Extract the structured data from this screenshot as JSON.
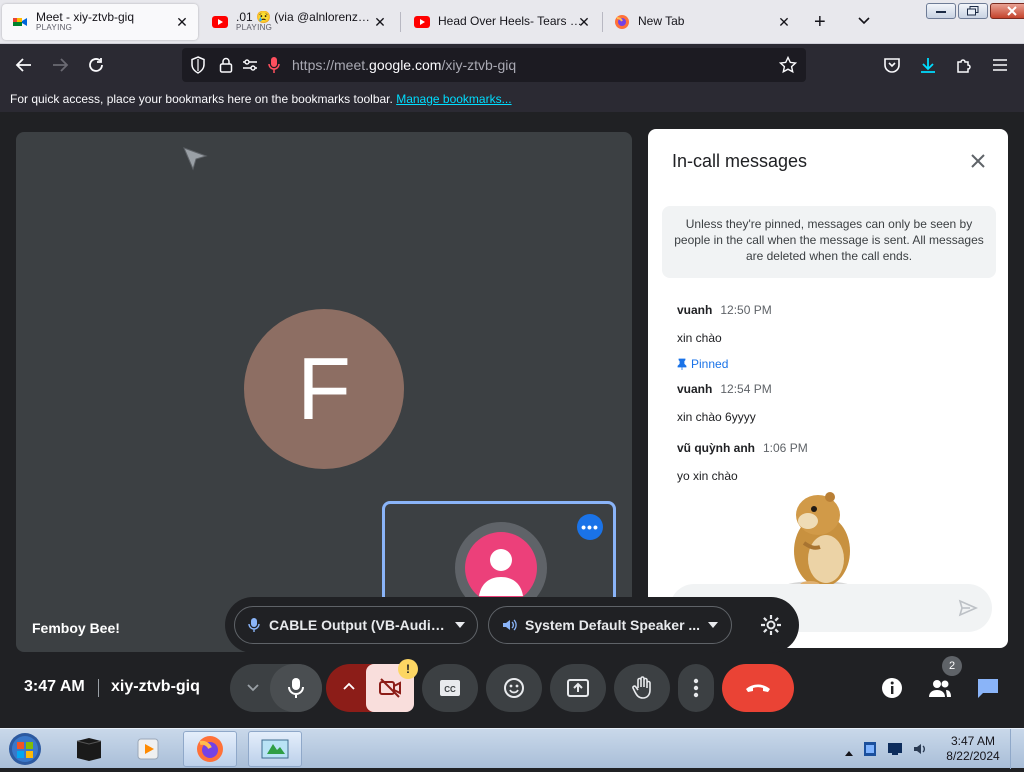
{
  "browser": {
    "tabs": [
      {
        "title": "Meet - xiy-ztvb-giq",
        "status": "PLAYING"
      },
      {
        "title": ".01 😢 (via @alnlorenzo/TT",
        "status": "PLAYING"
      },
      {
        "title": "Head Over Heels- Tears For",
        "status": ""
      },
      {
        "title": "New Tab",
        "status": ""
      }
    ],
    "url_prefix": "https://meet.",
    "url_domain": "google.com",
    "url_path": "/xiy-ztvb-giq",
    "bookmarks_hint": "For quick access, place your bookmarks here on the bookmarks toolbar.",
    "manage_bookmarks": "Manage bookmarks..."
  },
  "stage": {
    "avatar_letter": "F",
    "participant_name": "Femboy Bee!",
    "pip_more": "•••"
  },
  "devices": {
    "mic_label": "CABLE Output (VB-Audio...",
    "speaker_label": "System Default Speaker ..."
  },
  "chat": {
    "title": "In-call messages",
    "notice": "Unless they're pinned, messages can only be seen by people in the call when the message is sent. All messages are deleted when the call ends.",
    "messages": [
      {
        "sender": "vuanh",
        "time": "12:50 PM",
        "text": "xin chào",
        "pinned_label": "Pinned"
      },
      {
        "sender": "vuanh",
        "time": "12:54 PM",
        "text": "xin chào 6yyyy"
      },
      {
        "sender": "vũ quỳnh anh",
        "time": "1:06 PM",
        "text": "yo xin chào"
      }
    ]
  },
  "bottombar": {
    "time": "3:47 AM",
    "meeting_code": "xiy-ztvb-giq",
    "camera_warning": "!",
    "people_count": "2"
  },
  "taskbar": {
    "time": "3:47 AM",
    "date": "8/22/2024"
  },
  "colors": {
    "meet_bg": "#202124",
    "tile_bg": "#3c4043",
    "hangup_red": "#ea4335",
    "camera_off_bg": "#f9dedc",
    "accent_blue": "#1a73e8"
  }
}
